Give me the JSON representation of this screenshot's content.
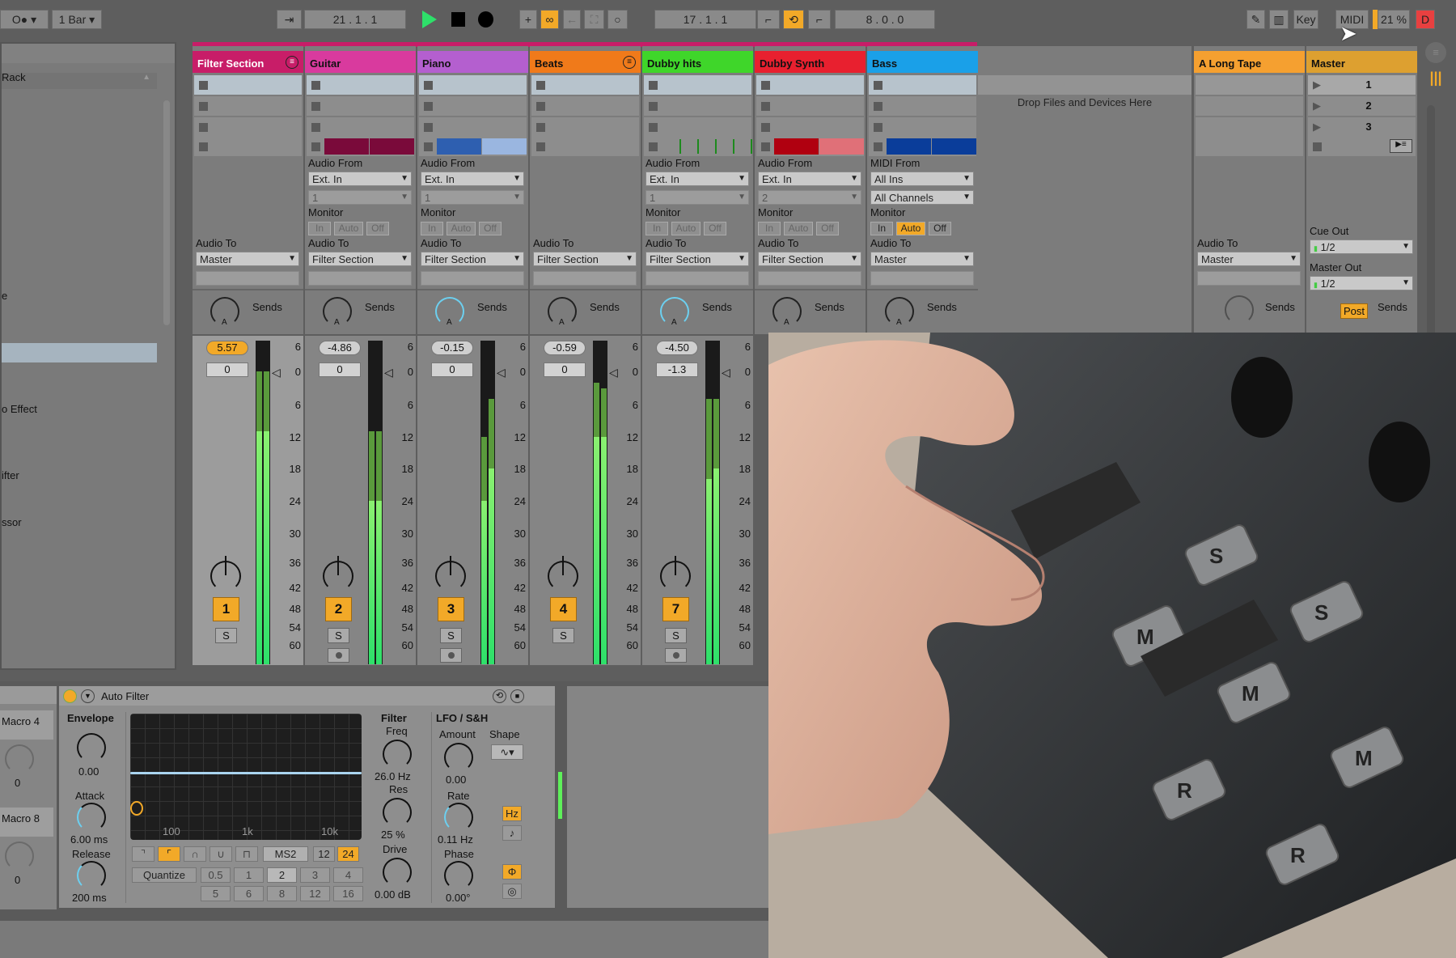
{
  "colors": {
    "accent": "#f2a928",
    "selected_clip": "#b7c3cc",
    "meter_light": "#5ef05a",
    "meter_dark": "#5a9a3c",
    "record": "#e84040"
  },
  "transport": {
    "metronome_label": "O●",
    "quantize": "1 Bar",
    "position": "21 .  1 .  1",
    "loop_start": "17 .  1 .  1",
    "loop_length": "8 .  0 .  0",
    "key_label": "Key",
    "midi_label": "MIDI",
    "cpu": "21 %",
    "d_label": "D"
  },
  "browser": {
    "items": [
      "Rack",
      "e",
      "o Effect",
      "ifter",
      "ssor"
    ],
    "selected_index": 1
  },
  "meter_ticks": [
    "6",
    "0",
    "6",
    "12",
    "18",
    "24",
    "30",
    "36",
    "42",
    "48",
    "54",
    "60"
  ],
  "tracks": [
    {
      "name": "Filter Section",
      "color": "#c81d68",
      "group": true,
      "clips": [
        null,
        null,
        null,
        null
      ],
      "audio_to": "Master",
      "volume": "5.57",
      "volume_active": true,
      "pan": "0",
      "number": "1",
      "arm": false,
      "send_active": false,
      "meter": {
        "peak": [
          0,
          0
        ],
        "rms": [
          -11,
          -11
        ]
      }
    },
    {
      "name": "Guitar",
      "color": "#d93a9e",
      "clips": [
        null,
        null,
        null,
        [
          "#7a0a3a",
          "#7a0a3a"
        ]
      ],
      "input_label": "Audio From",
      "input": "Ext. In",
      "channel": "1",
      "monitor": [
        "In",
        "Auto",
        "Off"
      ],
      "monitor_active": -1,
      "audio_to": "Filter Section",
      "volume": "-4.86",
      "pan": "0",
      "number": "2",
      "arm": true,
      "send_active": false,
      "meter": {
        "peak": [
          -11,
          -11
        ],
        "rms": [
          -24,
          -24
        ]
      }
    },
    {
      "name": "Piano",
      "color": "#b45fcf",
      "clips": [
        null,
        null,
        null,
        [
          "#2e5fb0",
          "#9ab6e0"
        ]
      ],
      "input_label": "Audio From",
      "input": "Ext. In",
      "channel": "1",
      "monitor": [
        "In",
        "Auto",
        "Off"
      ],
      "monitor_active": -1,
      "audio_to": "Filter Section",
      "volume": "-0.15",
      "pan": "0",
      "number": "3",
      "arm": true,
      "send_active": true,
      "meter": {
        "peak": [
          -12,
          -5
        ],
        "rms": [
          -24,
          -18
        ]
      }
    },
    {
      "name": "Beats",
      "color": "#f07a1a",
      "group": true,
      "clips": [
        null,
        null,
        null,
        null
      ],
      "audio_to": "Filter Section",
      "volume": "-0.59",
      "pan": "0",
      "number": "4",
      "arm": false,
      "send_active": false,
      "meter": {
        "peak": [
          -2,
          -3
        ],
        "rms": [
          -12,
          -12
        ]
      }
    },
    {
      "name": "Dubby hits",
      "color": "#3fd62a",
      "clips": [
        null,
        null,
        null,
        "ticks"
      ],
      "input_label": "Audio From",
      "input": "Ext. In",
      "channel": "1",
      "monitor": [
        "In",
        "Auto",
        "Off"
      ],
      "monitor_active": -1,
      "audio_to": "Filter Section",
      "volume": "-4.50",
      "pan": "-1.3",
      "number": "7",
      "arm": true,
      "send_active": true,
      "meter": {
        "peak": [
          -5,
          -5
        ],
        "rms": [
          -20,
          -18
        ]
      }
    },
    {
      "name": "Dubby Synth",
      "color": "#e8202f",
      "clips": [
        null,
        null,
        null,
        [
          "#b00010",
          "#e07078"
        ]
      ],
      "input_label": "Audio From",
      "input": "Ext. In",
      "channel": "2",
      "monitor": [
        "In",
        "Auto",
        "Off"
      ],
      "monitor_active": -1,
      "audio_to": "Filter Section",
      "send_active": false
    },
    {
      "name": "Bass",
      "color": "#1aa0e8",
      "clips": [
        null,
        null,
        null,
        [
          "#0a3d9a",
          "#0a3d9a"
        ]
      ],
      "input_label": "MIDI From",
      "input": "All Ins",
      "channel": "All Channels",
      "channel_active": true,
      "monitor": [
        "In",
        "Auto",
        "Off"
      ],
      "monitor_active": 1,
      "audio_to": "Master",
      "send_active": false
    }
  ],
  "drop_text": "Drop Files and Devices Here",
  "sends_label": "Sends",
  "audio_to_label": "Audio To",
  "monitor_label": "Monitor",
  "return_track": {
    "name": "A Long Tape",
    "color": "#f5a030",
    "audio_to": "Master"
  },
  "master": {
    "name": "Master",
    "color": "#dda030",
    "scenes": [
      "1",
      "2",
      "3"
    ],
    "cue_out_label": "Cue Out",
    "cue_out": "1/2",
    "master_out_label": "Master Out",
    "master_out": "1/2",
    "post_label": "Post"
  },
  "device": {
    "rack_macros": [
      {
        "label": "Macro 4",
        "value": "0"
      },
      {
        "label": "Macro 8",
        "value": "0"
      }
    ],
    "name": "Auto Filter",
    "envelope": {
      "title": "Envelope",
      "amount": "0.00",
      "attack_label": "Attack",
      "attack": "6.00 ms",
      "release_label": "Release",
      "release": "200 ms"
    },
    "graph_ticks": [
      "100",
      "1k",
      "10k"
    ],
    "filter_types": [
      "lowpass",
      "highpass",
      "bandpass",
      "notch",
      "morph"
    ],
    "filter_type_active": 1,
    "circuit": "MS2",
    "slopes": [
      "12",
      "24"
    ],
    "slope_active": 1,
    "quantize_label": "Quantize",
    "quantize_values": [
      "0.5",
      "1",
      "2",
      "3",
      "4",
      "5",
      "6",
      "8",
      "12",
      "16"
    ],
    "quantize_active": 2,
    "filter": {
      "title": "Filter",
      "freq_label": "Freq",
      "freq": "26.0 Hz",
      "res_label": "Res",
      "res": "25 %",
      "drive_label": "Drive",
      "drive": "0.00 dB"
    },
    "lfo": {
      "title": "LFO / S&H",
      "amount_label": "Amount",
      "amount": "0.00",
      "shape_label": "Shape",
      "rate_label": "Rate",
      "rate": "0.11 Hz",
      "rate_unit": "Hz",
      "phase_label": "Phase",
      "phase": "0.00°"
    }
  }
}
